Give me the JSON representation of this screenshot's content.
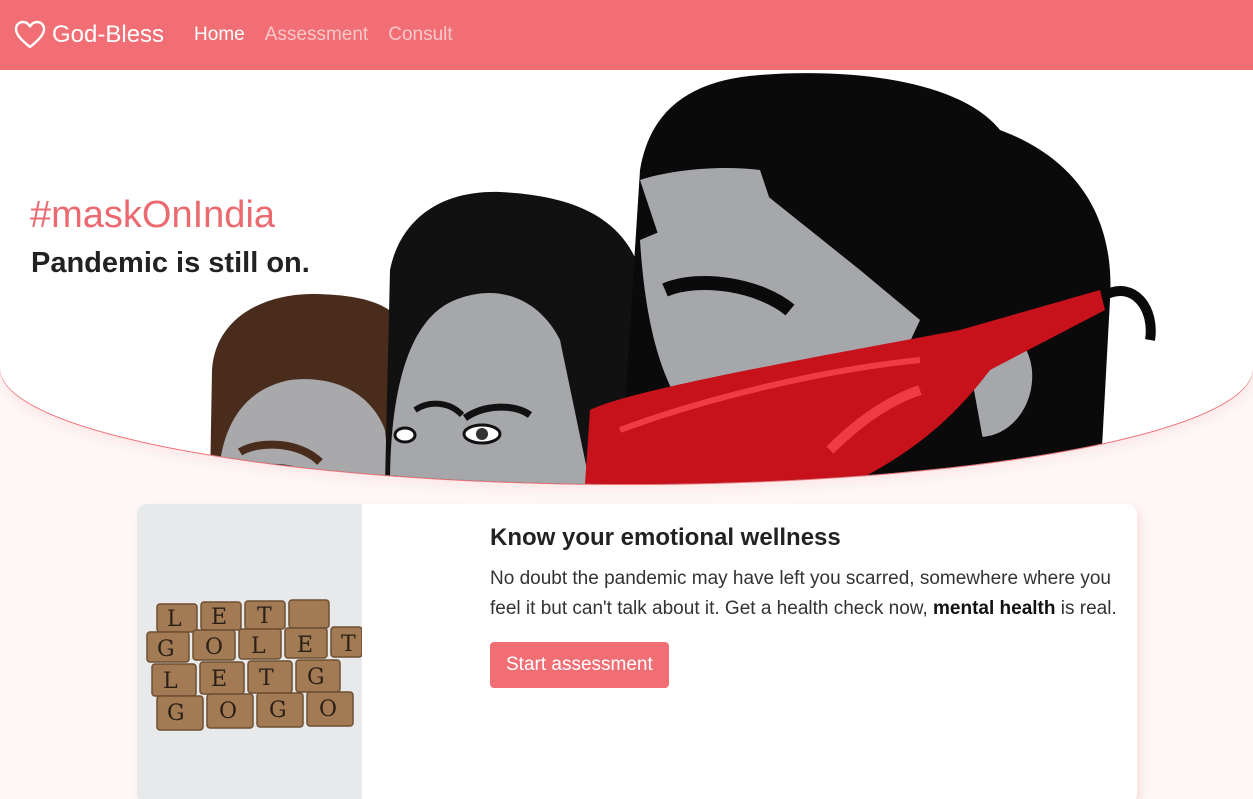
{
  "nav": {
    "brand": "God-Bless",
    "links": [
      {
        "label": "Home",
        "active": true
      },
      {
        "label": "Assessment",
        "active": false
      },
      {
        "label": "Consult",
        "active": false
      }
    ]
  },
  "hero": {
    "hashtag": "#maskOnIndia",
    "subtitle": "Pandemic is still on.",
    "illustration": "three-people-wearing-masks-illustration"
  },
  "card": {
    "image": "scrabble-tiles-let-go-photo",
    "title": "Know your emotional wellness",
    "text_before": "No doubt the pandemic may have left you scarred, somewhere where you feel it but can't talk about it. Get a health check now, ",
    "text_bold": "mental health",
    "text_after": " is real.",
    "button": "Start assessment"
  },
  "colors": {
    "brand": "#f06e74",
    "mask_red": "#d4141f",
    "background": "#fdf8f7"
  }
}
